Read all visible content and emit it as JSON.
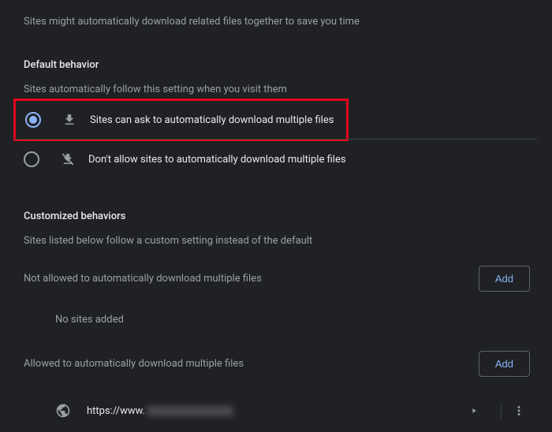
{
  "intro": "Sites might automatically download related files together to save you time",
  "defaultBehavior": {
    "title": "Default behavior",
    "subtitle": "Sites automatically follow this setting when you visit them",
    "optionAsk": "Sites can ask to automatically download multiple files",
    "optionBlock": "Don't allow sites to automatically download multiple files"
  },
  "customized": {
    "title": "Customized behaviors",
    "subtitle": "Sites listed below follow a custom setting instead of the default"
  },
  "notAllowed": {
    "title": "Not allowed to automatically download multiple files",
    "empty": "No sites added",
    "add": "Add"
  },
  "allowed": {
    "title": "Allowed to automatically download multiple files",
    "add": "Add",
    "site_prefix": "https://www."
  }
}
